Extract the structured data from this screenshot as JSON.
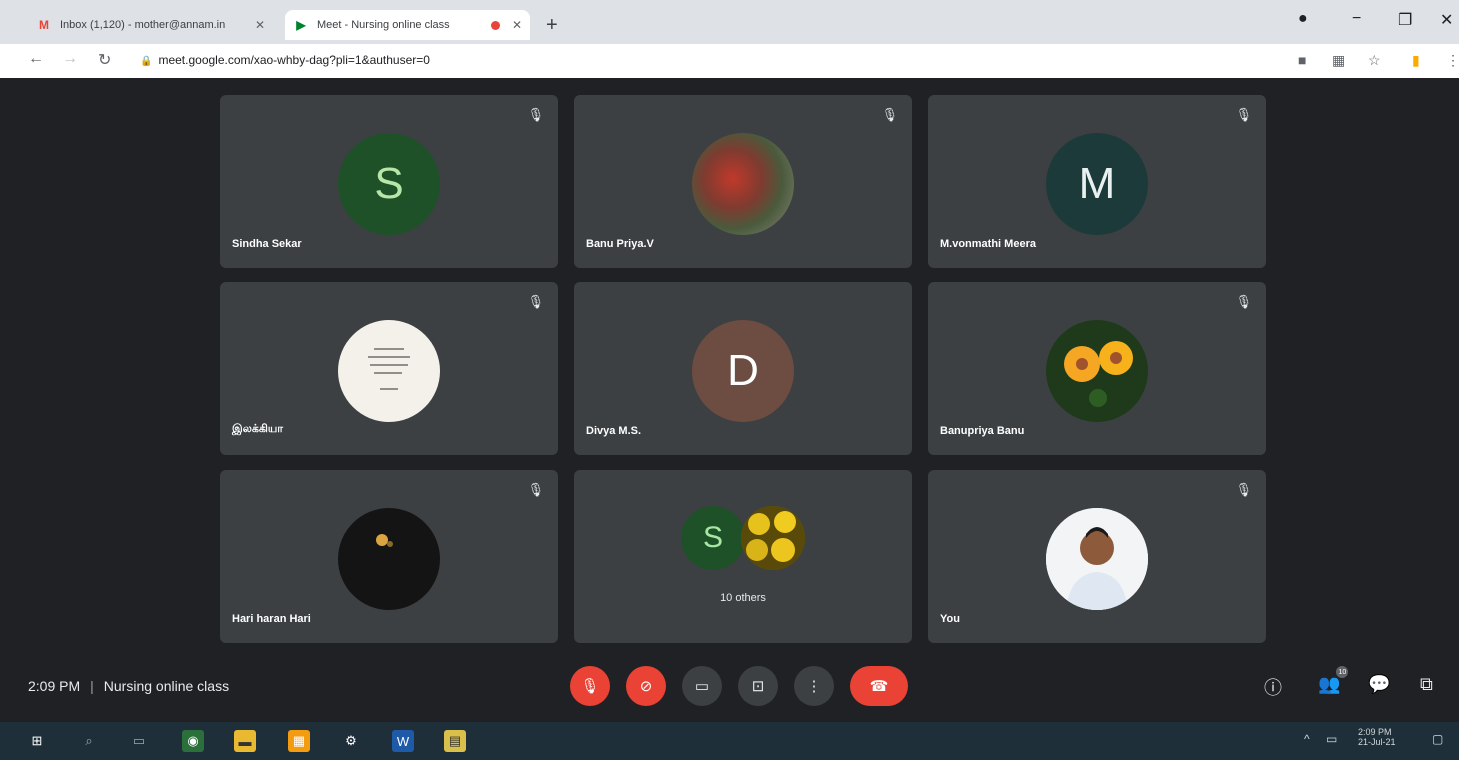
{
  "browser": {
    "tabs": [
      {
        "title": "Inbox (1,120) - mother@annam.in",
        "favicon": "gmail-icon"
      },
      {
        "title": "Meet - Nursing online class",
        "favicon": "meet-icon",
        "recording": true
      }
    ],
    "url": "meet.google.com/xao-whby-dag?pli=1&authuser=0"
  },
  "participants": [
    {
      "name": "Sindha Sekar",
      "initial": "S",
      "avatar_color": "#1e5128",
      "initial_color": "#b8e6a6",
      "kind": "initial"
    },
    {
      "name": "Banu Priya.V",
      "initial": "",
      "kind": "photo-red"
    },
    {
      "name": "M.vonmathi Meera",
      "initial": "M",
      "avatar_color": "#1d3a3a",
      "initial_color": "#e8f0f0",
      "kind": "initial"
    },
    {
      "name": "இலக்கியா",
      "initial": "",
      "kind": "photo-text"
    },
    {
      "name": "Divya M.S.",
      "initial": "D",
      "avatar_color": "#6d4c41",
      "initial_color": "#ffffff",
      "kind": "initial"
    },
    {
      "name": "Banupriya Banu",
      "initial": "",
      "kind": "photo-flowers"
    },
    {
      "name": "Hari haran Hari",
      "initial": "",
      "kind": "photo-dark"
    },
    {
      "name": "",
      "initial": "S",
      "kind": "others",
      "others_label": "10 others"
    },
    {
      "name": "You",
      "initial": "",
      "kind": "photo-you"
    }
  ],
  "meeting": {
    "time": "2:09 PM",
    "title": "Nursing online class",
    "participants_count": "10"
  },
  "taskbar": {
    "clock_time": "2:09 PM",
    "clock_date": "21-Jul-21"
  }
}
